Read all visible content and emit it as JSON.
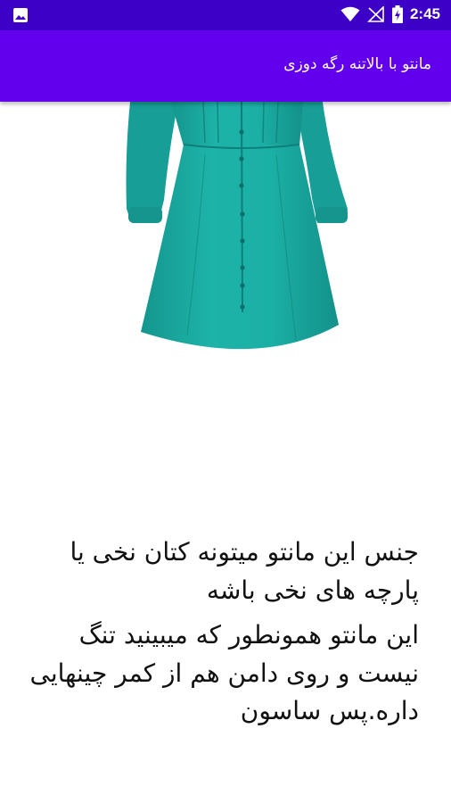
{
  "status_bar": {
    "time": "2:45",
    "icons": [
      "image-icon",
      "wifi-icon",
      "no-signal-icon",
      "battery-charging-icon"
    ]
  },
  "app_bar": {
    "title": "مانتو با بالاتنه رگه دوزی",
    "background": "#6200ee",
    "status_background": "#3d00c7"
  },
  "product_image": {
    "subject": "teal-shirt-dress-icon",
    "color": "#1aa9a0"
  },
  "description": {
    "paragraph_1": "جنس این مانتو میتونه کتان نخی یا پارچه های نخی باشه",
    "paragraph_2": "این مانتو همونطور که میبینید تنگ نیست و روی دامن هم از کمر چینهایی داره.پس ساسون"
  }
}
